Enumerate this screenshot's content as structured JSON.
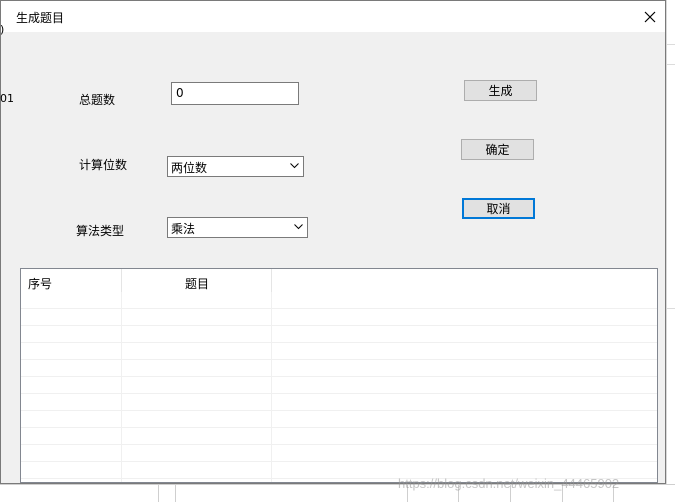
{
  "dialog": {
    "title": "生成题目",
    "close_glyph": "✕"
  },
  "form": {
    "total_label": "总题数",
    "total_value": "0",
    "digits_label": "计算位数",
    "digits_value": "两位数",
    "op_label": "算法类型",
    "op_value": "乘法"
  },
  "buttons": {
    "generate": "生成",
    "ok": "确定",
    "cancel": "取消"
  },
  "list": {
    "columns": [
      "序号",
      "题目"
    ]
  },
  "background": {
    "frag_top": ")",
    "frag_mid": "01"
  },
  "watermark": "https://blog.csdn.net/weixin_44465902",
  "colors": {
    "focus_border": "#0078d7",
    "dialog_bg": "#f0f0f0"
  }
}
